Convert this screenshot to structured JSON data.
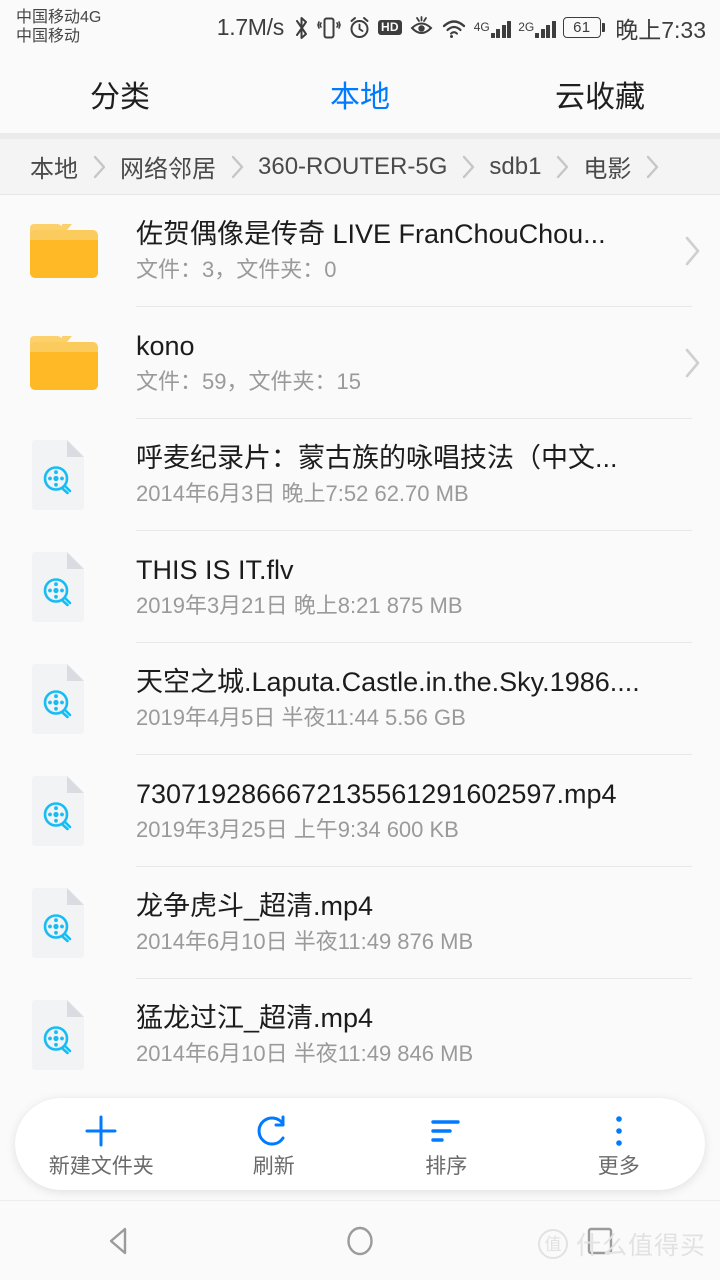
{
  "statusbar": {
    "carrier_line1": "中国移动4G",
    "carrier_line2": "中国移动",
    "net_speed": "1.7M/s",
    "time": "晚上7:33",
    "battery_percent": "61",
    "hd_label": "HD",
    "signal_1_label": "4G",
    "signal_2_label": "2G",
    "icons": [
      "bluetooth-icon",
      "vibrate-icon",
      "alarm-icon",
      "hd-icon",
      "eye-care-icon",
      "wifi-icon",
      "signal-icon",
      "signal-icon",
      "battery-icon"
    ]
  },
  "tabs": [
    {
      "label": "分类",
      "active": false
    },
    {
      "label": "本地",
      "active": true
    },
    {
      "label": "云收藏",
      "active": false
    }
  ],
  "accent_color": "#007aff",
  "folder_color": "#ffb926",
  "breadcrumb": [
    "本地",
    "网络邻居",
    "360-ROUTER-5G",
    "sdb1",
    "电影"
  ],
  "files": [
    {
      "type": "folder",
      "name": "佐贺偶像是传奇 LIVE FranChouChou...",
      "meta": "文件：3，文件夹：0",
      "has_chevron": true
    },
    {
      "type": "folder",
      "name": "kono",
      "meta": "文件：59，文件夹：15",
      "has_chevron": true
    },
    {
      "type": "video",
      "name": "呼麦纪录片：蒙古族的咏唱技法（中文...",
      "meta": "2014年6月3日 晚上7:52 62.70 MB",
      "has_chevron": false
    },
    {
      "type": "video",
      "name": "THIS IS IT.flv",
      "meta": "2019年3月21日 晚上8:21 875 MB",
      "has_chevron": false
    },
    {
      "type": "video",
      "name": "天空之城.Laputa.Castle.in.the.Sky.1986....",
      "meta": "2019年4月5日 半夜11:44 5.56 GB",
      "has_chevron": false
    },
    {
      "type": "video",
      "name": "7307192866672135561291602597.mp4",
      "meta": "2019年3月25日 上午9:34 600 KB",
      "has_chevron": false
    },
    {
      "type": "video",
      "name": "龙争虎斗_超清.mp4",
      "meta": "2014年6月10日 半夜11:49 876 MB",
      "has_chevron": false
    },
    {
      "type": "video",
      "name": "猛龙过江_超清.mp4",
      "meta": "2014年6月10日 半夜11:49 846 MB",
      "has_chevron": false
    }
  ],
  "toolbar": [
    {
      "icon": "plus-icon",
      "label": "新建文件夹"
    },
    {
      "icon": "refresh-icon",
      "label": "刷新"
    },
    {
      "icon": "sort-icon",
      "label": "排序"
    },
    {
      "icon": "more-vertical-icon",
      "label": "更多"
    }
  ],
  "navbar": {
    "back": "back-triangle-icon",
    "home": "home-circle-icon",
    "recents": "recents-square-icon"
  },
  "watermark": {
    "logo_char": "值",
    "text": "什么值得买"
  }
}
